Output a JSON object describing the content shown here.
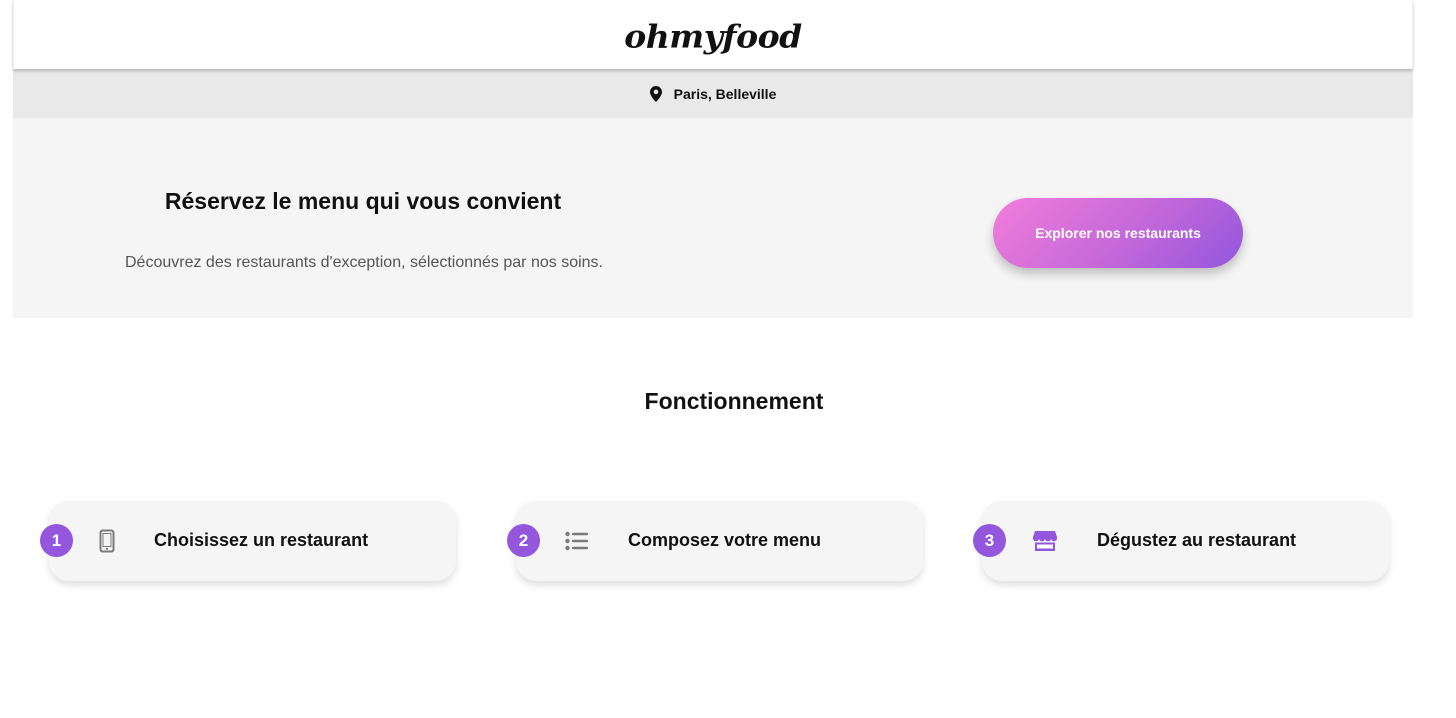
{
  "header": {
    "logo": "ohmyfood"
  },
  "location": {
    "icon": "location-pin-icon",
    "text": "Paris, Belleville"
  },
  "hero": {
    "title": "Réservez le menu qui vous convient",
    "subtitle": "Découvrez des restaurants d'exception, sélectionnés par nos soins.",
    "cta_label": "Explorer nos restaurants"
  },
  "how_it_works": {
    "title": "Fonctionnement",
    "steps": [
      {
        "number": "1",
        "icon": "mobile-phone-icon",
        "label": "Choisissez un restaurant"
      },
      {
        "number": "2",
        "icon": "list-icon",
        "label": "Composez votre menu"
      },
      {
        "number": "3",
        "icon": "store-icon",
        "label": "Dégustez au restaurant"
      }
    ]
  },
  "colors": {
    "primary": "#9356dc",
    "secondary": "#ff79da",
    "tertiary": "#99e2d0",
    "background": "#f5f5f5"
  }
}
